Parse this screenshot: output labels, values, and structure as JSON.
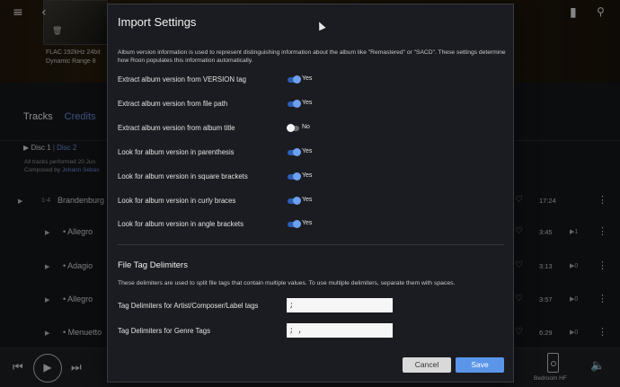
{
  "background": {
    "hero_lines": [
      "FLAC 192kHz 24bit",
      "Dynamic Range  8"
    ],
    "tabs": [
      "Tracks",
      "Credits"
    ],
    "disc_tabs": [
      "Disc 1",
      "Disc 2"
    ],
    "meta_lines": [
      {
        "text": "All tracks performed 20 Jun",
        "link": ""
      },
      {
        "text": "Composed by ",
        "link": "Johann Sebas"
      }
    ],
    "tracks": [
      {
        "num": "1-4",
        "title": "Brandenburg",
        "dur": "17:24",
        "plays": "",
        "sub": false
      },
      {
        "num": "",
        "title": "Allegro",
        "dur": "3:45",
        "plays": "1",
        "sub": true
      },
      {
        "num": "",
        "title": "Adagio",
        "dur": "3:13",
        "plays": "0",
        "sub": true
      },
      {
        "num": "",
        "title": "Allegro",
        "dur": "3:57",
        "plays": "0",
        "sub": true
      },
      {
        "num": "",
        "title": "Menuetto",
        "dur": "6:29",
        "plays": "0",
        "sub": true
      }
    ],
    "zone_name": "Bedroom HF"
  },
  "modal": {
    "title": "Import Settings",
    "description": "Album version information is used to represent distinguishing information about the album like \"Remastered\" or \"SACD\". These settings determine how Roon populates this information automatically.",
    "options": [
      {
        "label": "Extract album version from VERSION tag",
        "state": "Yes",
        "on": true
      },
      {
        "label": "Extract album version from file path",
        "state": "Yes",
        "on": true
      },
      {
        "label": "Extract album version from album title",
        "state": "No",
        "on": false
      },
      {
        "label": "Look for album version in parenthesis",
        "state": "Yes",
        "on": true
      },
      {
        "label": "Look for album version in square brackets",
        "state": "Yes",
        "on": true
      },
      {
        "label": "Look for album version in curly braces",
        "state": "Yes",
        "on": true
      },
      {
        "label": "Look for album version in angle brackets",
        "state": "Yes",
        "on": true
      }
    ],
    "delimiters": {
      "title": "File Tag Delimiters",
      "description": "These delimiters are used to split file tags that contain multiple values. To use multiple delimiters, separate them with spaces.",
      "fields": [
        {
          "label": "Tag Delimiters for Artist/Composer/Label tags",
          "value": ";"
        },
        {
          "label": "Tag Delimiters for Genre Tags",
          "value": "; ,"
        }
      ]
    },
    "buttons": {
      "cancel": "Cancel",
      "save": "Save"
    }
  },
  "colors": {
    "accent": "#5b95ea",
    "toggle_on": "#2c5fb3",
    "link": "#6c8fe0"
  },
  "icons": [
    "menu-icon",
    "back-icon",
    "forward-icon",
    "bookmark-icon",
    "search-icon",
    "trash-icon",
    "heart-icon",
    "more-icon",
    "previous-icon",
    "play-icon",
    "next-icon",
    "speaker-icon",
    "volume-icon"
  ]
}
